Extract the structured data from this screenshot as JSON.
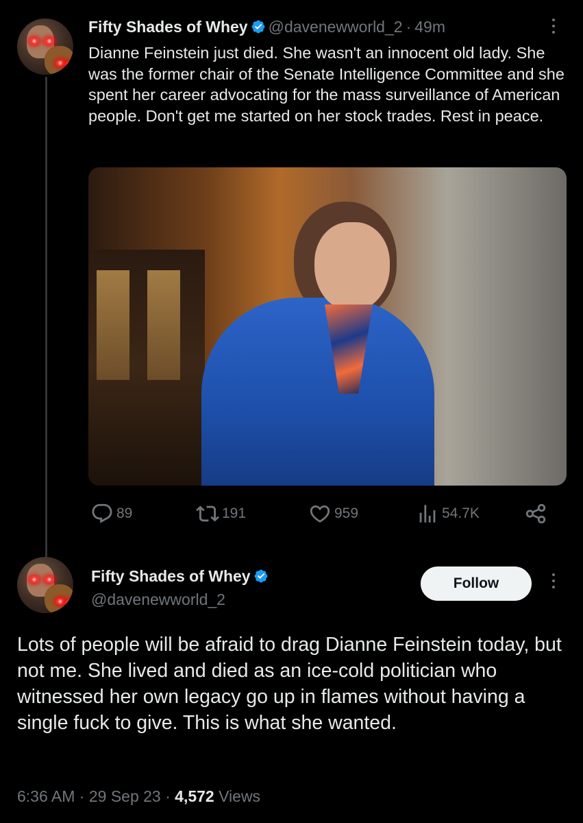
{
  "reply_tweet": {
    "author_name": "Fifty Shades of Whey",
    "handle": "@davenewworld_2",
    "separator": "·",
    "time_ago": "49m",
    "text": "Dianne Feinstein just died. She wasn't an innocent old lady. She was the former chair of the Senate Intelligence Committee and she spent her career advocating for the mass surveillance of American people. Don't get me started on her stock trades. Rest in peace.",
    "actions": {
      "replies": "89",
      "reposts": "191",
      "likes": "959",
      "views": "54.7K"
    }
  },
  "main_tweet": {
    "author_name": "Fifty Shades of Whey",
    "handle": "@davenewworld_2",
    "follow_label": "Follow",
    "text": "Lots of people will be afraid to drag Dianne Feinstein today, but not me. She lived and died as an ice-cold politician who witnessed her own legacy go up in flames without having a single fuck to give. This is what she wanted.",
    "time": "6:36 AM",
    "sep1": "·",
    "date": "29 Sep 23",
    "sep2": "·",
    "views_count": "4,572",
    "views_label": "Views"
  },
  "icons": {
    "verified": "verified-badge-icon",
    "more": "more-vertical-icon",
    "reply": "reply-icon",
    "repost": "repost-icon",
    "like": "heart-icon",
    "views": "views-bar-chart-icon",
    "share": "share-icon"
  },
  "colors": {
    "background": "#000000",
    "text": "#e7e9ea",
    "muted": "#71767b",
    "verified_blue": "#1d9bf0",
    "thread_line": "#333639"
  }
}
